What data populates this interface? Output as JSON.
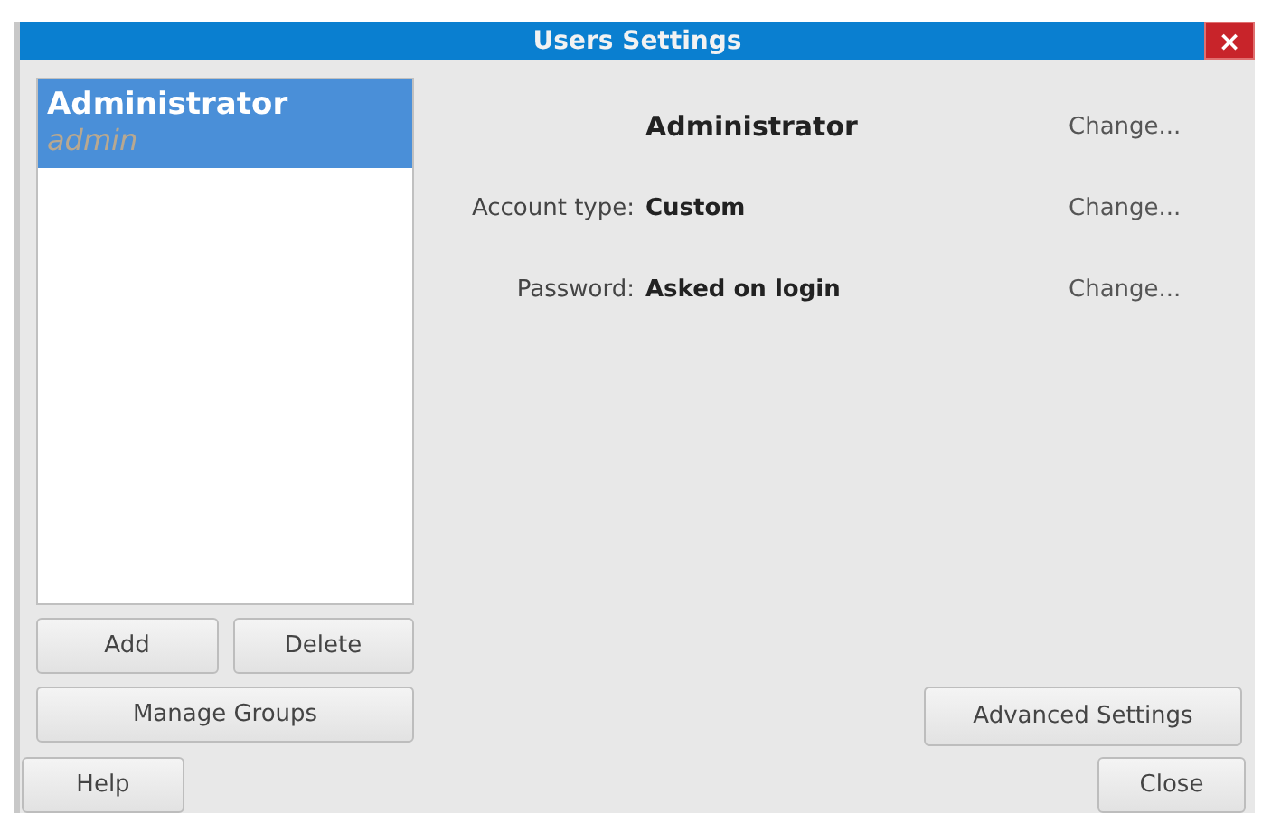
{
  "window": {
    "title": "Users Settings",
    "close": "×"
  },
  "users": [
    {
      "name": "Administrator",
      "login": "admin",
      "selected": true
    }
  ],
  "user_buttons": [
    "Add",
    "Delete"
  ],
  "manage_groups": "Manage Groups",
  "header": {
    "name": "Administrator",
    "change": "Change..."
  },
  "fields": [
    {
      "label": "Account type:",
      "value": "Custom",
      "change": "Change..."
    },
    {
      "label": "Password:",
      "value": "Asked on login",
      "change": "Change..."
    }
  ],
  "advanced": "Advanced Settings",
  "help": "Help",
  "close_button": "Close"
}
